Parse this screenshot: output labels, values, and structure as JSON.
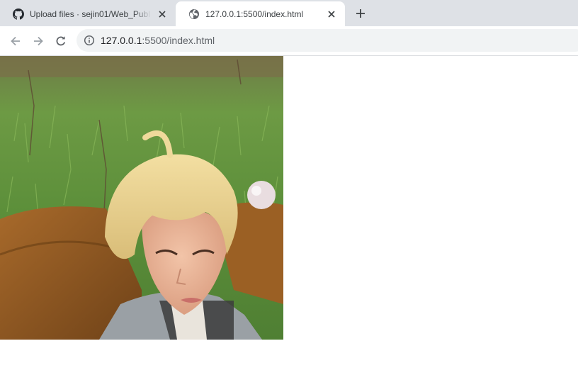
{
  "tabs": [
    {
      "title": "Upload files · sejin01/Web_Publ",
      "icon": "github-icon",
      "active": false
    },
    {
      "title": "127.0.0.1:5500/index.html",
      "icon": "globe-icon",
      "active": true
    }
  ],
  "toolbar": {
    "url_host": "127.0.0.1",
    "url_rest": ":5500/index.html"
  },
  "page": {
    "image_alt": "photo"
  },
  "colors": {
    "tabstrip": "#dee1e6",
    "omnibox": "#f1f3f4",
    "icon": "#5f6368"
  }
}
